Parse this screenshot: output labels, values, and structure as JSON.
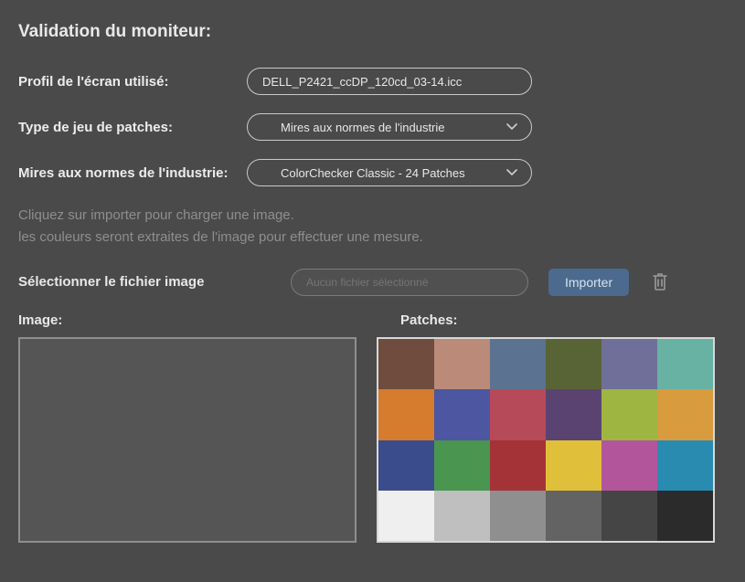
{
  "title": "Validation du moniteur:",
  "labels": {
    "profile": "Profil de l'écran utilisé:",
    "patchset_type": "Type de jeu de patches:",
    "industry_targets": "Mires aux normes de l'industrie:",
    "select_file": "Sélectionner le fichier image",
    "image": "Image:",
    "patches": "Patches:"
  },
  "values": {
    "profile": "DELL_P2421_ccDP_120cd_03-14.icc",
    "patchset_type": "Mires aux normes de l'industrie",
    "industry_targets": "ColorChecker Classic - 24 Patches",
    "file_placeholder": "Aucun fichier sélectionné"
  },
  "helper": {
    "line1": "Cliquez sur importer pour charger une image.",
    "line2": "les couleurs seront extraites de l'image pour effectuer une mesure."
  },
  "buttons": {
    "import": "Importer"
  },
  "patches": [
    "#6f4c3e",
    "#bb8a79",
    "#5b7390",
    "#596436",
    "#6f6f99",
    "#68b2a3",
    "#d67c2e",
    "#4d56a0",
    "#b74a58",
    "#5a4371",
    "#9fb541",
    "#d89b3e",
    "#3a4c8b",
    "#4a9550",
    "#a43337",
    "#e0c03b",
    "#b3559a",
    "#2a8bb0",
    "#efefef",
    "#bfbfbf",
    "#8f8f8f",
    "#636363",
    "#454545",
    "#2b2b2b"
  ]
}
